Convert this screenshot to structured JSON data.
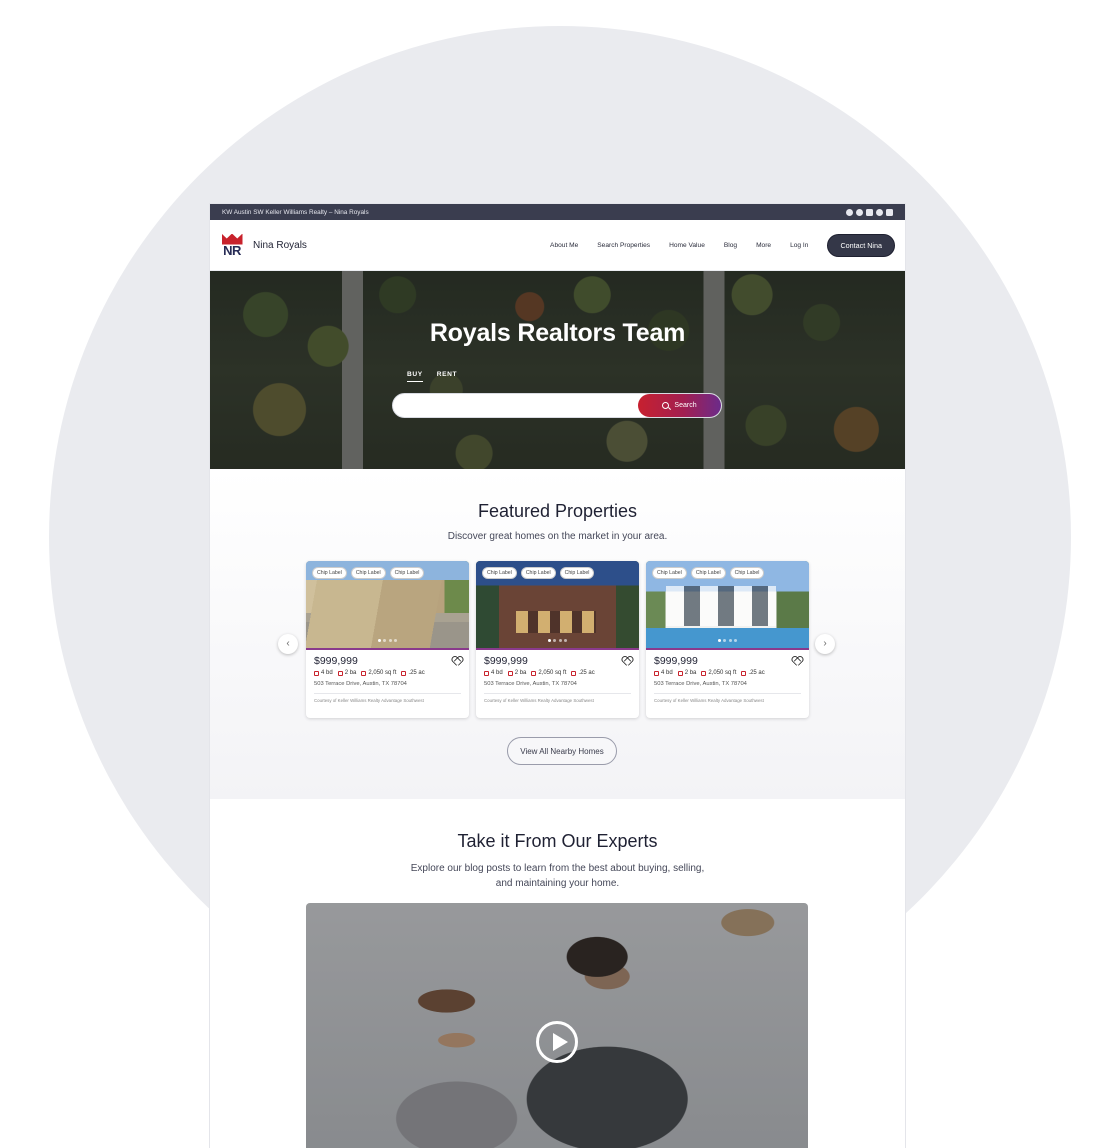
{
  "topbar": {
    "text": "KW Austin SW Keller Williams Realty – Nina Royals",
    "social_icons": [
      "facebook-icon",
      "instagram-icon",
      "linkedin-icon",
      "twitter-icon",
      "youtube-icon"
    ]
  },
  "nav": {
    "logo_text": "NR",
    "brand": "Nina Royals",
    "links": [
      "About Me",
      "Search Properties",
      "Home Value",
      "Blog",
      "More",
      "Log In"
    ],
    "cta": "Contact Nina"
  },
  "hero": {
    "title": "Royals Realtors Team",
    "tabs": [
      "BUY",
      "RENT"
    ],
    "active_tab": "BUY",
    "search_value": "",
    "search_button": "Search"
  },
  "featured": {
    "title": "Featured Properties",
    "subtitle": "Discover great homes on the market in your area.",
    "cards": [
      {
        "chips": [
          "Chip Label",
          "Chip Label",
          "Chip Label"
        ],
        "price": "$999,999",
        "beds": "4 bd",
        "baths": "2 ba",
        "sqft": "2,050 sq ft",
        "lot": ".25 ac",
        "address": "503 Terrace Drive, Austin, TX 78704",
        "courtesy": "Courtesy of Keller Williams Realty Advantage Southwest"
      },
      {
        "chips": [
          "Chip Label",
          "Chip Label",
          "Chip Label"
        ],
        "price": "$999,999",
        "beds": "4 bd",
        "baths": "2 ba",
        "sqft": "2,050 sq ft",
        "lot": ".25 ac",
        "address": "503 Terrace Drive, Austin, TX 78704",
        "courtesy": "Courtesy of Keller Williams Realty Advantage Southwest"
      },
      {
        "chips": [
          "Chip Label",
          "Chip Label",
          "Chip Label"
        ],
        "price": "$999,999",
        "beds": "4 bd",
        "baths": "2 ba",
        "sqft": "2,050 sq ft",
        "lot": ".25 ac",
        "address": "503 Terrace Drive, Austin, TX 78704",
        "courtesy": "Courtesy of Keller Williams Realty Advantage Southwest"
      }
    ],
    "prev_arrow": "‹",
    "next_arrow": "›",
    "view_all": "View All Nearby Homes"
  },
  "experts": {
    "title": "Take it From Our Experts",
    "subtitle_line1": "Explore our blog posts to learn from the best about buying, selling,",
    "subtitle_line2": "and maintaining your home."
  },
  "colors": {
    "brand_red": "#c8222c",
    "brand_navy": "#262b55",
    "dark_bar": "#3a3d4f",
    "search_gradient_start": "#c7202f",
    "search_gradient_end": "#6b2b8a"
  }
}
